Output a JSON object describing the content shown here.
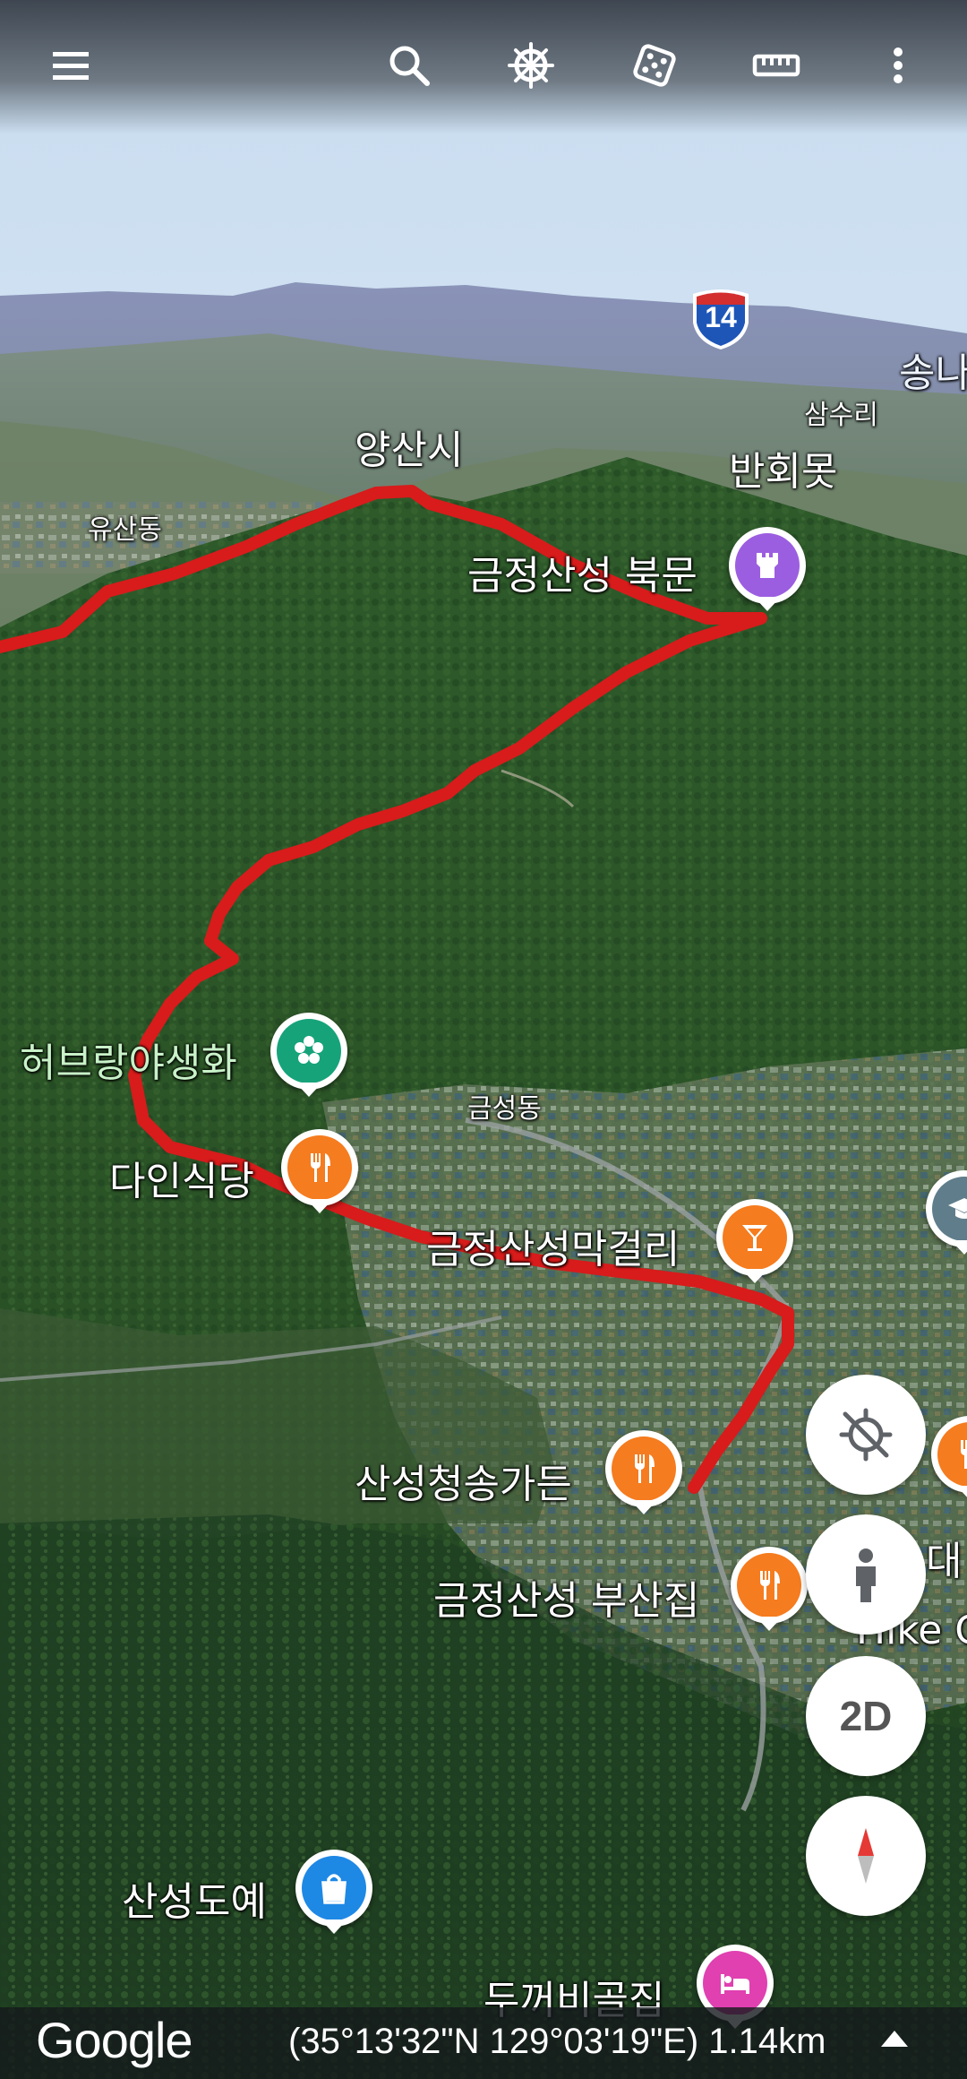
{
  "toolbar": {
    "icons": [
      "menu-icon",
      "search-icon",
      "voyager-wheel-icon",
      "feeling-lucky-dice-icon",
      "measure-ruler-icon",
      "more-vert-icon"
    ]
  },
  "map": {
    "highway_shield": "14",
    "places": {
      "yangsan": "양산시",
      "songna": "송나",
      "samsuri": "삼수리",
      "banhoemot": "반회못",
      "yusandong": "유산동",
      "geumseongdong": "금성동",
      "hike_partial": "Hike C",
      "dae_partial": "대"
    },
    "pois": {
      "north_gate": "금정산성 북문",
      "herb": "허브랑야생화",
      "dain": "다인식당",
      "makgeolli": "금정산성막걸리",
      "cheongsong": "산성청송가든",
      "busanjip": "금정산성 부산집",
      "dovye": "산성도예",
      "dukkebi": "두꺼비골집"
    },
    "colors": {
      "track": "#d81b1b",
      "castle_pin": "#9c5ee0",
      "flower_pin": "#16a37a",
      "food_pin": "#f57c1f",
      "bar_pin": "#f57c1f",
      "shopping_pin": "#1e88e5",
      "lodging_pin": "#e040b0",
      "school_pin": "#607d8b"
    }
  },
  "controls": {
    "view_mode_label": "2D",
    "icons": [
      "location-off-icon",
      "street-view-pegman-icon",
      "compass-icon"
    ]
  },
  "footer": {
    "logo": "Google",
    "coordinates": "(35°13'32\"N 129°03'19\"E) 1.14km"
  }
}
